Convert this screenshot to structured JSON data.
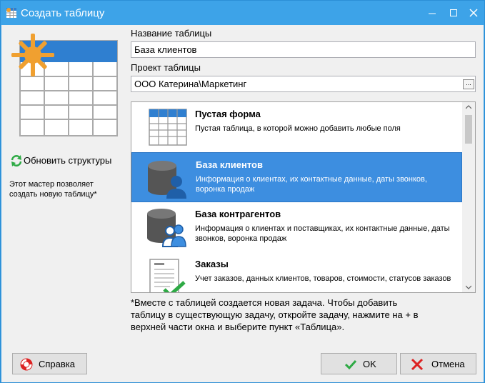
{
  "window": {
    "title": "Создать таблицу"
  },
  "form": {
    "name_label": "Название таблицы",
    "name_value": "База клиентов",
    "project_label": "Проект таблицы",
    "project_value": "ООО Катерина\\Маркетинг",
    "browse_label": "..."
  },
  "sidebar": {
    "refresh_label": "Обновить структуры",
    "description": "Этот мастер позволяет создать новую таблицу*"
  },
  "templates": [
    {
      "title": "Пустая форма",
      "desc": "Пустая таблица, в которой можно добавить любые поля",
      "icon": "table-icon",
      "selected": false
    },
    {
      "title": "База клиентов",
      "desc": "Информация о клиентах, их контактные данные, даты звонков, воронка продаж",
      "icon": "database-user-icon",
      "selected": true
    },
    {
      "title": "База контрагентов",
      "desc": "Информация о клиентах и поставщиках, их контактные данные, даты звонков, воронка продаж",
      "icon": "database-users-icon",
      "selected": false
    },
    {
      "title": "Заказы",
      "desc": "Учет заказов, данных клиентов, товаров, стоимости, статусов заказов",
      "icon": "order-icon",
      "selected": false
    }
  ],
  "note": "*Вместе с таблицей создается новая задача. Чтобы добавить таблицу в существующую задачу, откройте задачу, нажмите на + в верхней части окна и выберите пункт «Таблица».",
  "buttons": {
    "help": "Справка",
    "ok": "OK",
    "cancel": "Отмена"
  },
  "colors": {
    "titlebar": "#3da3e8",
    "selection": "#3d8ee0",
    "accent_orange": "#f0a030"
  }
}
